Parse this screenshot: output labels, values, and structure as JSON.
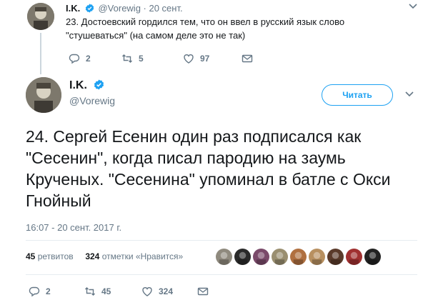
{
  "parent_tweet": {
    "name": "I.K.",
    "handle_date": "@Vorewig · 20 сент.",
    "text": "23. Достоевский гордился тем, что он ввел в русский язык слово \"стушеваться\" (на самом деле это не так)",
    "replies": "2",
    "retweets": "5",
    "likes": "97"
  },
  "main_tweet": {
    "name": "I.K.",
    "handle": "@Vorewig",
    "follow_label": "Читать",
    "text": "24. Сергей Есенин один раз подписался как \"Сесенин\", когда писал пародию на заумь Крученых. \"Сесенина\" упоминал в батле с Окси Гнойный",
    "timestamp": "16:07 - 20 сент. 2017 г.",
    "retweets_count": "45",
    "retweets_label": "ретвитов",
    "likes_count": "324",
    "likes_label": "отметки «Нравится»",
    "actions": {
      "replies": "2",
      "retweets": "45",
      "likes": "324"
    },
    "liker_colors": [
      "#8f8a7e",
      "#2a2a2a",
      "#7a4a6a",
      "#9a8f70",
      "#b07040",
      "#b89060",
      "#5a3a2a",
      "#a03030",
      "#222222"
    ]
  },
  "colors": {
    "accent": "#1da1f2",
    "verified": "#1da1f2",
    "muted": "#657786",
    "text": "#14171a",
    "divider": "#e6ecf0"
  },
  "icons": [
    "verified-badge-icon",
    "chevron-down-icon",
    "reply-icon",
    "retweet-icon",
    "like-icon",
    "direct-message-icon"
  ]
}
